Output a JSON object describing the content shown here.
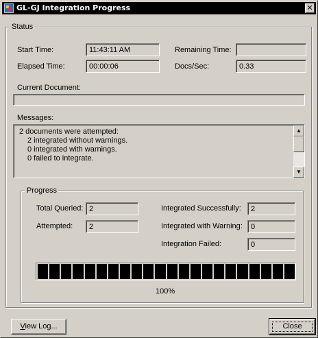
{
  "window": {
    "title": "GL-GJ Integration Progress",
    "close_glyph": "✕"
  },
  "status": {
    "group_label": "Status",
    "start_time_label": "Start Time:",
    "start_time_value": "11:43:11 AM",
    "elapsed_time_label": "Elapsed Time:",
    "elapsed_time_value": "00:00:06",
    "remaining_time_label": "Remaining Time:",
    "remaining_time_value": "",
    "docs_per_sec_label": "Docs/Sec:",
    "docs_per_sec_value": "0.33",
    "current_document_label": "Current Document:",
    "current_document_value": "",
    "messages_label": "Messages:",
    "messages": [
      "2 documents were attempted:",
      "2 integrated without warnings.",
      "0 integrated with warnings.",
      "0 failed to integrate."
    ]
  },
  "progress": {
    "group_label": "Progress",
    "total_queried_label": "Total Queried:",
    "total_queried_value": "2",
    "attempted_label": "Attempted:",
    "attempted_value": "2",
    "integrated_successfully_label": "Integrated Successfully:",
    "integrated_successfully_value": "2",
    "integrated_with_warning_label": "Integrated with Warning:",
    "integrated_with_warning_value": "0",
    "integration_failed_label": "Integration Failed:",
    "integration_failed_value": "0",
    "percent_text": "100%",
    "fraction": 1.0
  },
  "buttons": {
    "view_log_prefix": "",
    "view_log_mnemonic": "V",
    "view_log_rest": "iew Log...",
    "close_label": "Close"
  },
  "icons": {
    "scroll_up": "▲",
    "scroll_down": "▼"
  }
}
